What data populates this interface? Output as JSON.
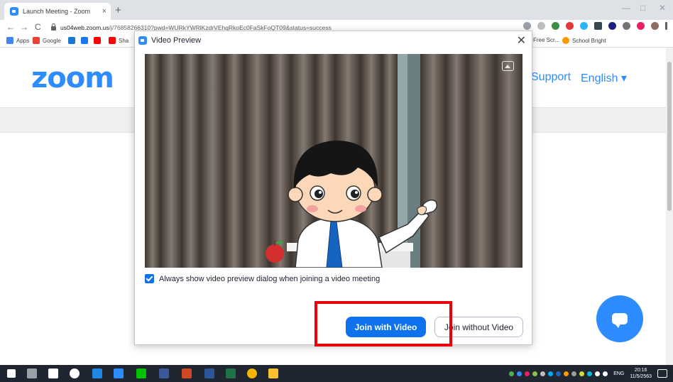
{
  "browser": {
    "tab_title": "Launch Meeting - Zoom",
    "tab_close": "×",
    "new_tab": "+",
    "window_minimize": "—",
    "window_maximize": "□",
    "window_close": "✕",
    "back": "←",
    "forward": "→",
    "reload": "C",
    "url_host": "us04web.zoom.us",
    "url_path": "/j/76858266310?pwd=WURkYWRlKzdrVEhqRkoEc0FaSkFoQT09&status=success",
    "bookmarks": [
      "Apps",
      "Google",
      "Sha",
      "Free Scr...",
      "School Bright"
    ]
  },
  "page": {
    "logo": "zoom",
    "nav_support": "Support",
    "nav_language": "English ▾"
  },
  "dialog": {
    "title": "Video Preview",
    "close": "✕",
    "always_show_label": "Always show video preview dialog when joining a video meeting",
    "always_show_checked": true,
    "join_with_video": "Join with Video",
    "join_without_video": "Join without Video"
  },
  "taskbar": {
    "language": "ENG",
    "time": "20:16",
    "date": "11/5/2563"
  },
  "colors": {
    "zoom_blue": "#2d8cff",
    "button_blue": "#0e72ed",
    "highlight_red": "#e8000c"
  }
}
